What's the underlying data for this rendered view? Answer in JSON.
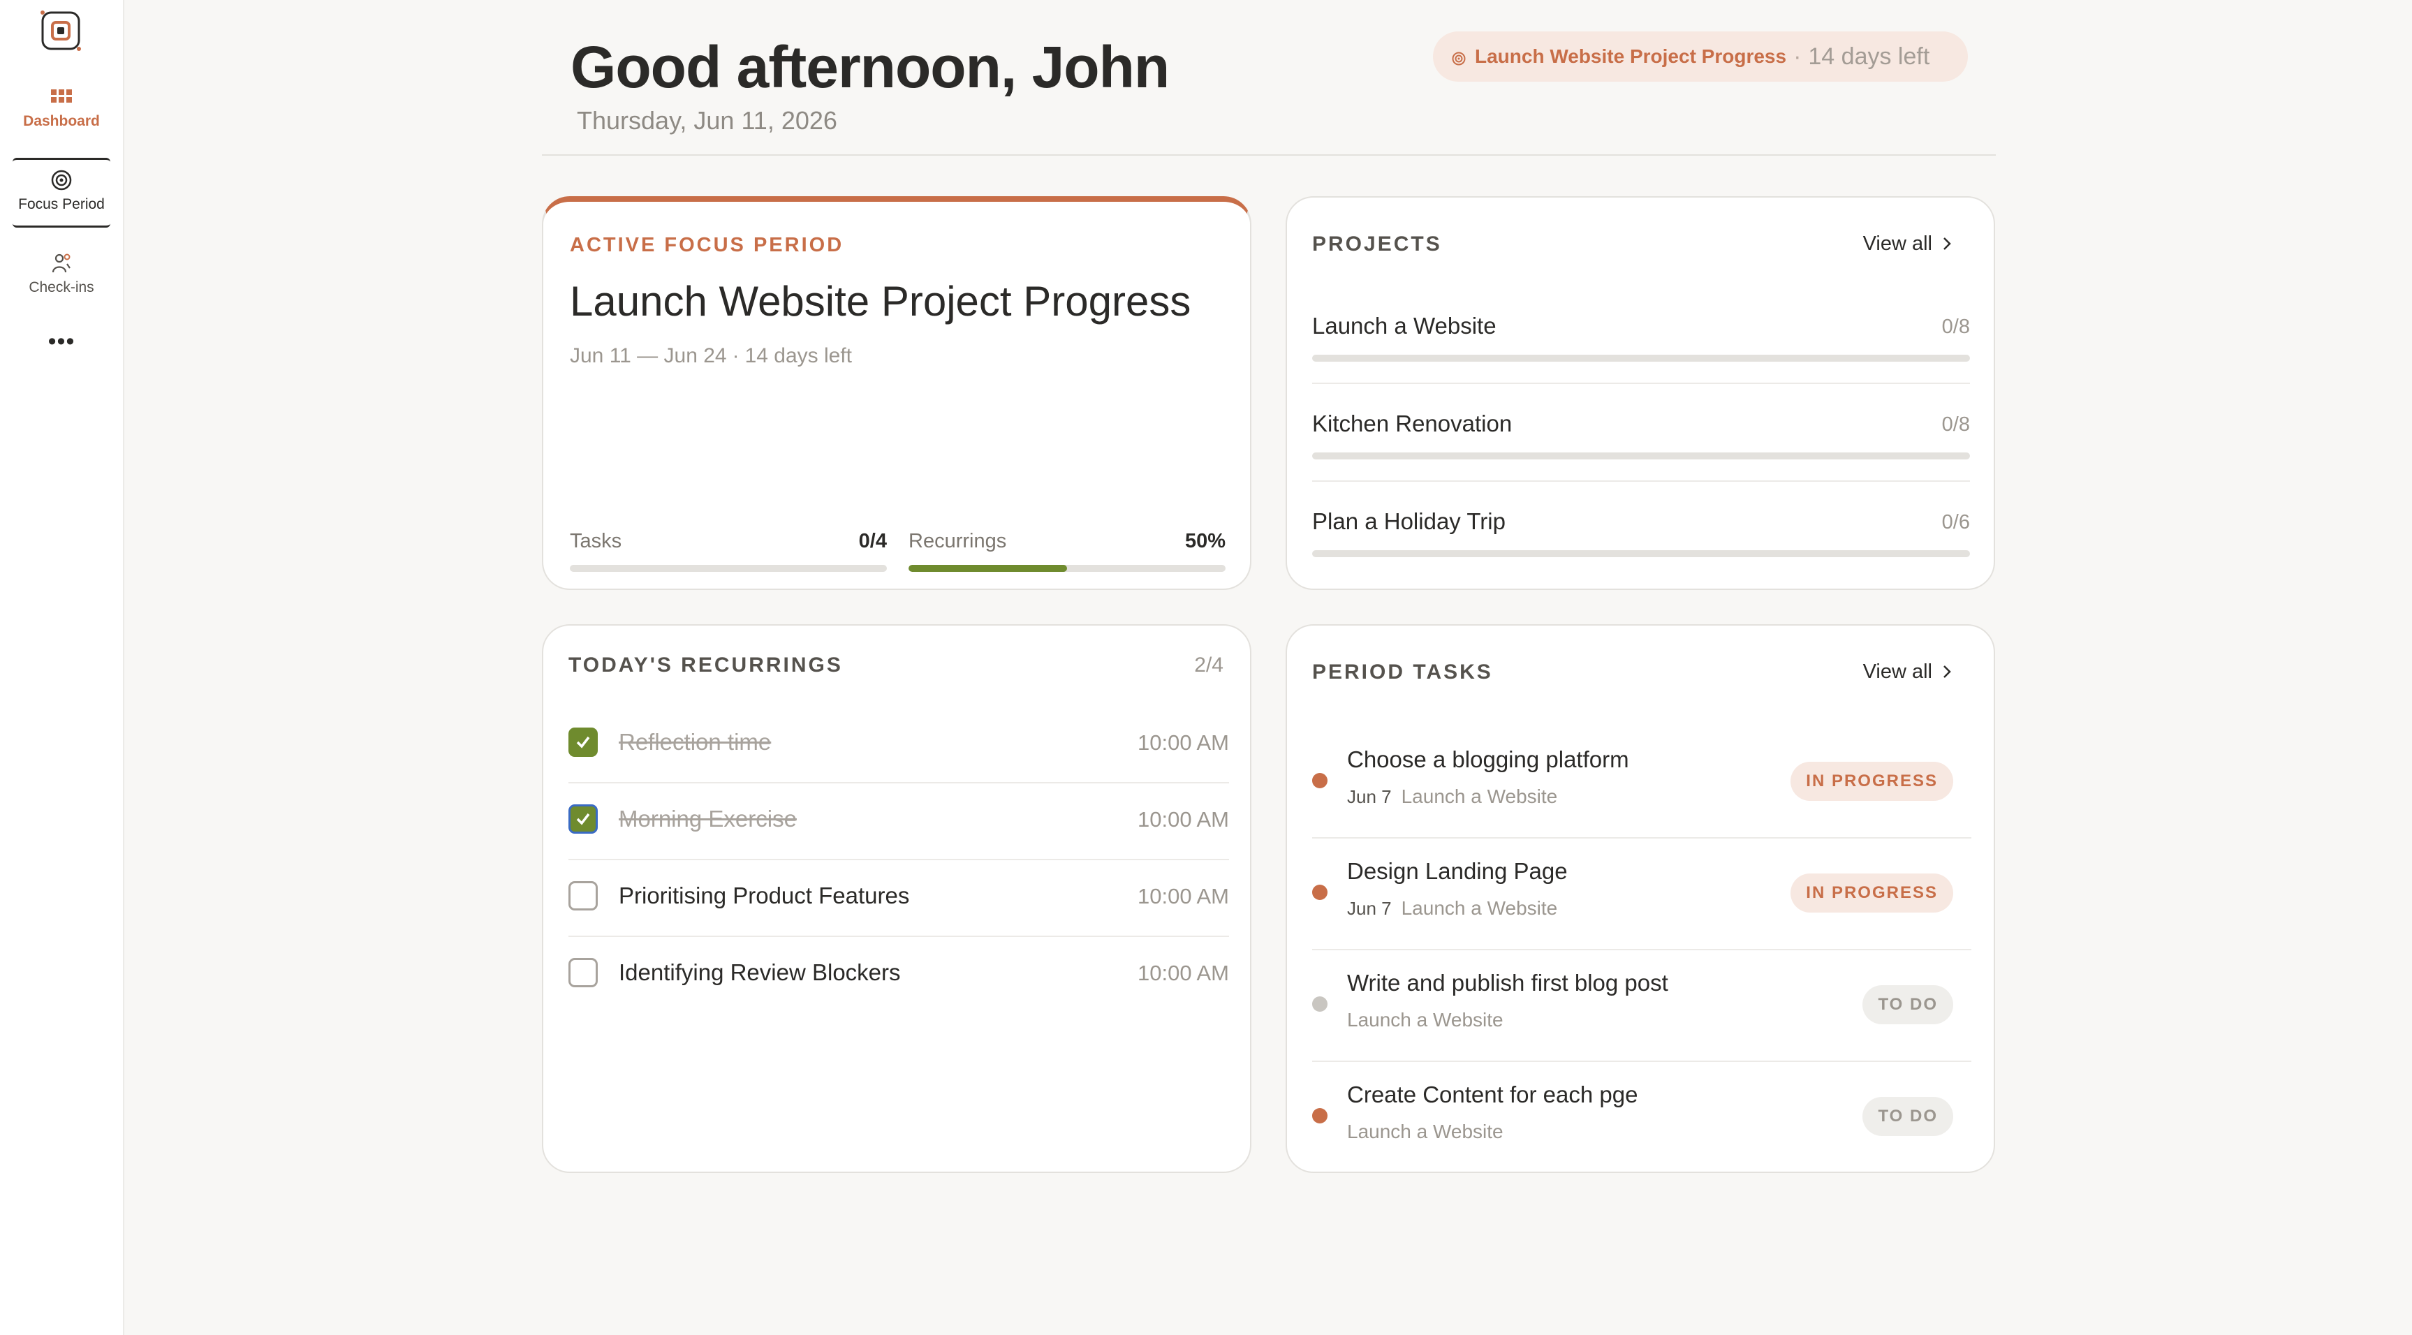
{
  "sidebar": {
    "items": [
      {
        "label": "Dashboard"
      },
      {
        "label": "Focus Period"
      },
      {
        "label": "Check-ins"
      },
      {
        "label": "•••"
      }
    ]
  },
  "header": {
    "greeting": "Good afternoon, John",
    "date": "Thursday, Jun 11, 2026",
    "focus_pill": {
      "name": "Launch Website Project Progress",
      "separator": "·",
      "days_left": "14 days left"
    }
  },
  "active_focus": {
    "label": "ACTIVE FOCUS PERIOD",
    "title": "Launch Website Project Progress",
    "range": "Jun 11 — Jun 24",
    "separator": "·",
    "days_left": "14 days left",
    "tasks": {
      "label": "Tasks",
      "value": "0/4",
      "progress": 0
    },
    "recurrings": {
      "label": "Recurrings",
      "value": "50%",
      "progress": 0.5
    }
  },
  "projects": {
    "title": "PROJECTS",
    "view_all": "View all",
    "items": [
      {
        "name": "Launch a Website",
        "count": "0/8",
        "progress": 0
      },
      {
        "name": "Kitchen Renovation",
        "count": "0/8",
        "progress": 0
      },
      {
        "name": "Plan a Holiday Trip",
        "count": "0/6",
        "progress": 0
      }
    ]
  },
  "recurrings": {
    "title": "TODAY'S RECURRINGS",
    "count": "2/4",
    "items": [
      {
        "name": "Reflection time",
        "time": "10:00 AM",
        "done": true
      },
      {
        "name": "Morning Exercise",
        "time": "10:00 AM",
        "done": true
      },
      {
        "name": "Prioritising Product Features",
        "time": "10:00 AM",
        "done": false
      },
      {
        "name": "Identifying Review Blockers",
        "time": "10:00 AM",
        "done": false
      }
    ]
  },
  "period_tasks": {
    "title": "PERIOD TASKS",
    "view_all": "View all",
    "items": [
      {
        "name": "Choose a blogging platform",
        "date": "Jun 7",
        "project": "Launch a Website",
        "status": "IN PROGRESS",
        "dot_color": "#c86e48"
      },
      {
        "name": "Design Landing Page",
        "date": "Jun 7",
        "project": "Launch a Website",
        "status": "IN PROGRESS",
        "dot_color": "#c86e48"
      },
      {
        "name": "Write and publish first blog post",
        "date": "",
        "project": "Launch a Website",
        "status": "TO DO",
        "dot_color": "#c9c6c1"
      },
      {
        "name": "Create Content for each pge",
        "date": "",
        "project": "Launch a Website",
        "status": "TO DO",
        "dot_color": "#c86e48"
      }
    ]
  },
  "colors": {
    "accent": "#c86e48",
    "success": "#6f8b2e",
    "background": "#f8f7f5"
  }
}
